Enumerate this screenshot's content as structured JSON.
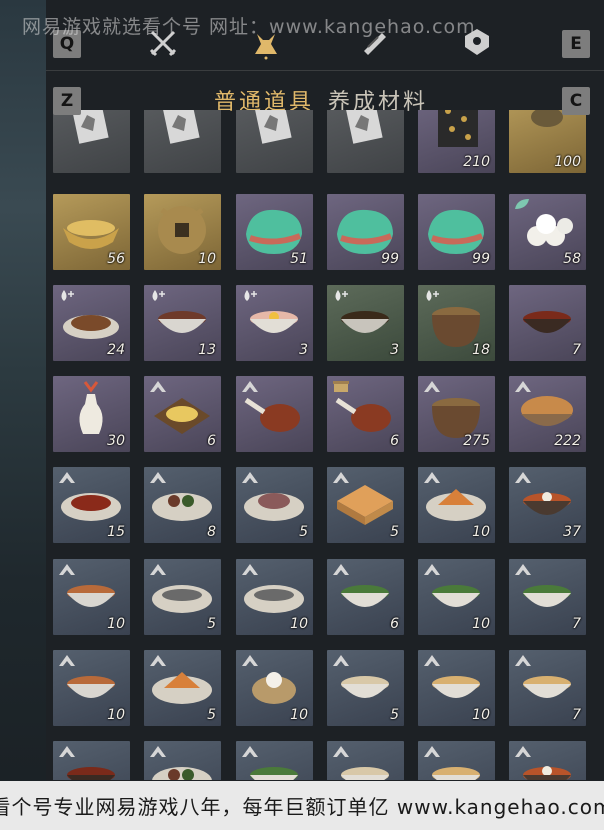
{
  "watermark_top": "网易游戏就选看个号  网址：www.kangehao.com",
  "watermark_bottom": "看个号专业网易游戏八年，每年巨额订单亿 www.kangehao.com",
  "keys": {
    "q": "Q",
    "e": "E",
    "z": "Z",
    "c": "C"
  },
  "top_icons": [
    "crossed-swords-icon",
    "bundle-icon",
    "scroll-icon",
    "location-icon"
  ],
  "tabs": [
    {
      "label": "普通道具",
      "active": true
    },
    {
      "label": "养成材料",
      "active": false
    }
  ],
  "rows": [
    [
      {
        "art": "card",
        "rarity": "grey",
        "count": ""
      },
      {
        "art": "card",
        "rarity": "grey",
        "count": ""
      },
      {
        "art": "card",
        "rarity": "grey",
        "count": ""
      },
      {
        "art": "card",
        "rarity": "grey",
        "count": ""
      },
      {
        "art": "coins-string",
        "rarity": "purple",
        "count": "210"
      },
      {
        "art": "pot",
        "rarity": "gold",
        "count": "100"
      }
    ],
    [
      {
        "art": "gold-ingot",
        "rarity": "gold",
        "count": "56"
      },
      {
        "art": "coin",
        "rarity": "gold",
        "count": "10"
      },
      {
        "art": "jade",
        "rarity": "purple",
        "count": "51"
      },
      {
        "art": "jade",
        "rarity": "purple",
        "count": "99"
      },
      {
        "art": "jade",
        "rarity": "purple",
        "count": "99"
      },
      {
        "art": "buns",
        "rarity": "purple",
        "count": "58",
        "badge": "leaf"
      }
    ],
    [
      {
        "art": "dish-meat",
        "rarity": "purple",
        "count": "24",
        "badge": "drop"
      },
      {
        "art": "bowl-meat",
        "rarity": "purple",
        "count": "13",
        "badge": "drop"
      },
      {
        "art": "bowl-egg",
        "rarity": "purple",
        "count": "3",
        "badge": "drop"
      },
      {
        "art": "bowl-dark",
        "rarity": "green",
        "count": "3",
        "badge": "drop"
      },
      {
        "art": "clay-pot",
        "rarity": "green",
        "count": "18",
        "badge": "drop"
      },
      {
        "art": "bowl-red",
        "rarity": "purple",
        "count": "7"
      }
    ],
    [
      {
        "art": "vase",
        "rarity": "purple",
        "count": "30"
      },
      {
        "art": "tray",
        "rarity": "purple",
        "count": "6",
        "badge": "arrow"
      },
      {
        "art": "drumstick",
        "rarity": "purple",
        "count": "",
        "badge": "arrow"
      },
      {
        "art": "drumstick",
        "rarity": "purple",
        "count": "6",
        "badge": "box"
      },
      {
        "art": "clay-pot",
        "rarity": "purple",
        "count": "275",
        "badge": "arrow"
      },
      {
        "art": "bread-bowl",
        "rarity": "purple",
        "count": "222",
        "badge": "arrow"
      }
    ],
    [
      {
        "art": "plate-meat",
        "rarity": "blue",
        "count": "15",
        "badge": "arrow"
      },
      {
        "art": "plate-mixed",
        "rarity": "blue",
        "count": "8",
        "badge": "arrow"
      },
      {
        "art": "plate-pork",
        "rarity": "blue",
        "count": "5",
        "badge": "arrow"
      },
      {
        "art": "cake",
        "rarity": "blue",
        "count": "5",
        "badge": "arrow"
      },
      {
        "art": "plate-pie",
        "rarity": "blue",
        "count": "10",
        "badge": "arrow"
      },
      {
        "art": "bowl-stew",
        "rarity": "blue",
        "count": "37",
        "badge": "arrow"
      }
    ],
    [
      {
        "art": "bowl-soup",
        "rarity": "blue",
        "count": "10",
        "badge": "arrow"
      },
      {
        "art": "plate-fish",
        "rarity": "blue",
        "count": "5",
        "badge": "arrow"
      },
      {
        "art": "plate-fish",
        "rarity": "blue",
        "count": "10",
        "badge": "arrow"
      },
      {
        "art": "bowl-greens",
        "rarity": "blue",
        "count": "6",
        "badge": "arrow"
      },
      {
        "art": "bowl-greens",
        "rarity": "blue",
        "count": "10",
        "badge": "arrow"
      },
      {
        "art": "bowl-greens",
        "rarity": "blue",
        "count": "7",
        "badge": "arrow"
      }
    ],
    [
      {
        "art": "bowl-soup",
        "rarity": "blue",
        "count": "10",
        "badge": "arrow"
      },
      {
        "art": "plate-pie",
        "rarity": "blue",
        "count": "5",
        "badge": "arrow"
      },
      {
        "art": "steamer",
        "rarity": "blue",
        "count": "10",
        "badge": "arrow"
      },
      {
        "art": "bowl-light",
        "rarity": "blue",
        "count": "5",
        "badge": "arrow"
      },
      {
        "art": "bowl-noodle",
        "rarity": "blue",
        "count": "10",
        "badge": "arrow"
      },
      {
        "art": "bowl-noodle",
        "rarity": "blue",
        "count": "7",
        "badge": "arrow"
      }
    ],
    [
      {
        "art": "bowl-red",
        "rarity": "blue",
        "count": "",
        "badge": "arrow"
      },
      {
        "art": "plate-mixed",
        "rarity": "blue",
        "count": "",
        "badge": "arrow"
      },
      {
        "art": "bowl-greens",
        "rarity": "blue",
        "count": "",
        "badge": "arrow"
      },
      {
        "art": "bowl-light",
        "rarity": "blue",
        "count": "",
        "badge": "arrow"
      },
      {
        "art": "bowl-noodle",
        "rarity": "blue",
        "count": "",
        "badge": "arrow"
      },
      {
        "art": "bowl-stew",
        "rarity": "blue",
        "count": "",
        "badge": "arrow"
      }
    ]
  ]
}
